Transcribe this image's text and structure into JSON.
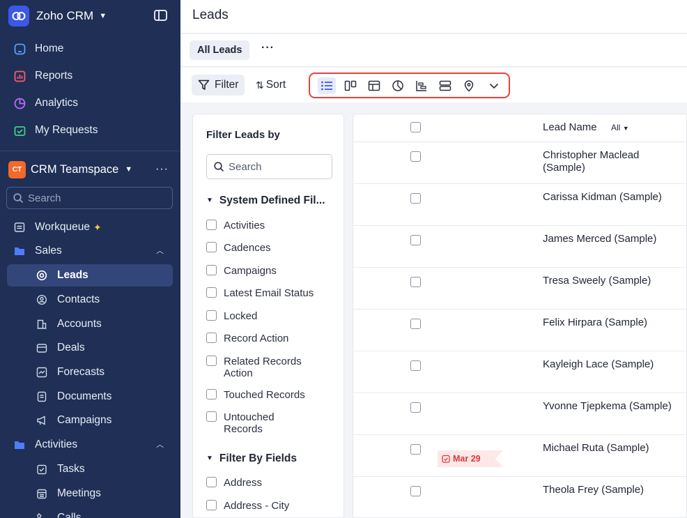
{
  "app": {
    "name": "Zoho CRM"
  },
  "sidebar": {
    "top_items": [
      {
        "label": "Home",
        "icon": "home-icon"
      },
      {
        "label": "Reports",
        "icon": "reports-icon"
      },
      {
        "label": "Analytics",
        "icon": "analytics-icon"
      },
      {
        "label": "My Requests",
        "icon": "requests-icon"
      }
    ],
    "teamspace": {
      "badge": "CT",
      "name": "CRM Teamspace"
    },
    "search_placeholder": "Search",
    "workqueue": "Workqueue",
    "sales_group": "Sales",
    "sales_items": [
      "Leads",
      "Contacts",
      "Accounts",
      "Deals",
      "Forecasts",
      "Documents",
      "Campaigns"
    ],
    "activities_group": "Activities",
    "activities_items": [
      "Tasks",
      "Meetings",
      "Calls"
    ],
    "active_item": "Leads",
    "accent_color": "#3c58e6"
  },
  "header": {
    "title": "Leads"
  },
  "view_bar": {
    "tab": "All Leads",
    "more": "···"
  },
  "toolbar": {
    "filter_label": "Filter",
    "sort_label": "Sort",
    "highlight_color": "#e8413b"
  },
  "filter_panel": {
    "title": "Filter Leads by",
    "search_placeholder": "Search",
    "system_section": "System Defined Fil...",
    "system_items": [
      "Activities",
      "Cadences",
      "Campaigns",
      "Latest Email Status",
      "Locked",
      "Record Action",
      "Related Records Action",
      "Touched Records",
      "Untouched Records"
    ],
    "fields_section": "Filter By Fields",
    "field_items": [
      "Address",
      "Address - City"
    ]
  },
  "table": {
    "column": "Lead Name",
    "column_filter": "All",
    "rows": [
      "Christopher Maclead (Sample)",
      "Carissa Kidman (Sample)",
      "James Merced (Sample)",
      "Tresa Sweely (Sample)",
      "Felix Hirpara (Sample)",
      "Kayleigh Lace (Sample)",
      "Yvonne Tjepkema (Sample)",
      "Michael Ruta (Sample)",
      "Theola Frey (Sample)"
    ],
    "due_tag": "Mar 29"
  }
}
